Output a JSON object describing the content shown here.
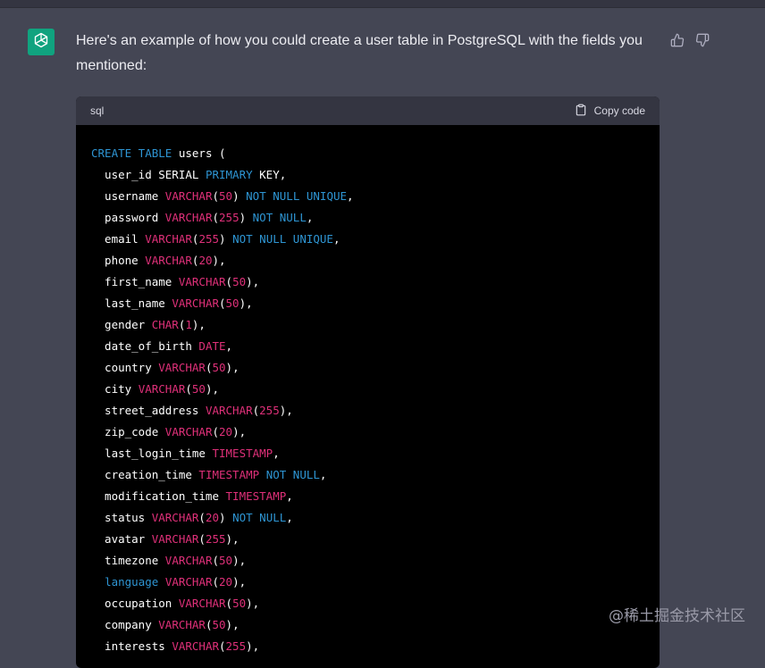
{
  "message": {
    "intro": "Here's an example of how you could create a user table in PostgreSQL with the fields you mentioned:"
  },
  "code_block": {
    "language": "sql",
    "copy_label": "Copy code",
    "lines": [
      [
        [
          "CREATE TABLE",
          "kw"
        ],
        [
          " users (",
          "plain"
        ]
      ],
      [
        [
          "  user_id SERIAL ",
          "plain"
        ],
        [
          "PRIMARY",
          "kw"
        ],
        [
          " KEY,",
          "plain"
        ]
      ],
      [
        [
          "  username ",
          "plain"
        ],
        [
          "VARCHAR",
          "type"
        ],
        [
          "(",
          "plain"
        ],
        [
          "50",
          "num"
        ],
        [
          ") ",
          "plain"
        ],
        [
          "NOT NULL UNIQUE",
          "kw"
        ],
        [
          ",",
          "plain"
        ]
      ],
      [
        [
          "  password ",
          "plain"
        ],
        [
          "VARCHAR",
          "type"
        ],
        [
          "(",
          "plain"
        ],
        [
          "255",
          "num"
        ],
        [
          ") ",
          "plain"
        ],
        [
          "NOT NULL",
          "kw"
        ],
        [
          ",",
          "plain"
        ]
      ],
      [
        [
          "  email ",
          "plain"
        ],
        [
          "VARCHAR",
          "type"
        ],
        [
          "(",
          "plain"
        ],
        [
          "255",
          "num"
        ],
        [
          ") ",
          "plain"
        ],
        [
          "NOT NULL UNIQUE",
          "kw"
        ],
        [
          ",",
          "plain"
        ]
      ],
      [
        [
          "  phone ",
          "plain"
        ],
        [
          "VARCHAR",
          "type"
        ],
        [
          "(",
          "plain"
        ],
        [
          "20",
          "num"
        ],
        [
          "),",
          "plain"
        ]
      ],
      [
        [
          "  first_name ",
          "plain"
        ],
        [
          "VARCHAR",
          "type"
        ],
        [
          "(",
          "plain"
        ],
        [
          "50",
          "num"
        ],
        [
          "),",
          "plain"
        ]
      ],
      [
        [
          "  last_name ",
          "plain"
        ],
        [
          "VARCHAR",
          "type"
        ],
        [
          "(",
          "plain"
        ],
        [
          "50",
          "num"
        ],
        [
          "),",
          "plain"
        ]
      ],
      [
        [
          "  gender ",
          "plain"
        ],
        [
          "CHAR",
          "type"
        ],
        [
          "(",
          "plain"
        ],
        [
          "1",
          "num"
        ],
        [
          "),",
          "plain"
        ]
      ],
      [
        [
          "  date_of_birth ",
          "plain"
        ],
        [
          "DATE",
          "type"
        ],
        [
          ",",
          "plain"
        ]
      ],
      [
        [
          "  country ",
          "plain"
        ],
        [
          "VARCHAR",
          "type"
        ],
        [
          "(",
          "plain"
        ],
        [
          "50",
          "num"
        ],
        [
          "),",
          "plain"
        ]
      ],
      [
        [
          "  city ",
          "plain"
        ],
        [
          "VARCHAR",
          "type"
        ],
        [
          "(",
          "plain"
        ],
        [
          "50",
          "num"
        ],
        [
          "),",
          "plain"
        ]
      ],
      [
        [
          "  street_address ",
          "plain"
        ],
        [
          "VARCHAR",
          "type"
        ],
        [
          "(",
          "plain"
        ],
        [
          "255",
          "num"
        ],
        [
          "),",
          "plain"
        ]
      ],
      [
        [
          "  zip_code ",
          "plain"
        ],
        [
          "VARCHAR",
          "type"
        ],
        [
          "(",
          "plain"
        ],
        [
          "20",
          "num"
        ],
        [
          "),",
          "plain"
        ]
      ],
      [
        [
          "  last_login_time ",
          "plain"
        ],
        [
          "TIMESTAMP",
          "type"
        ],
        [
          ",",
          "plain"
        ]
      ],
      [
        [
          "  creation_time ",
          "plain"
        ],
        [
          "TIMESTAMP",
          "type"
        ],
        [
          " ",
          "plain"
        ],
        [
          "NOT NULL",
          "kw"
        ],
        [
          ",",
          "plain"
        ]
      ],
      [
        [
          "  modification_time ",
          "plain"
        ],
        [
          "TIMESTAMP",
          "type"
        ],
        [
          ",",
          "plain"
        ]
      ],
      [
        [
          "  status ",
          "plain"
        ],
        [
          "VARCHAR",
          "type"
        ],
        [
          "(",
          "plain"
        ],
        [
          "20",
          "num"
        ],
        [
          ") ",
          "plain"
        ],
        [
          "NOT NULL",
          "kw"
        ],
        [
          ",",
          "plain"
        ]
      ],
      [
        [
          "  avatar ",
          "plain"
        ],
        [
          "VARCHAR",
          "type"
        ],
        [
          "(",
          "plain"
        ],
        [
          "255",
          "num"
        ],
        [
          "),",
          "plain"
        ]
      ],
      [
        [
          "  timezone ",
          "plain"
        ],
        [
          "VARCHAR",
          "type"
        ],
        [
          "(",
          "plain"
        ],
        [
          "50",
          "num"
        ],
        [
          "),",
          "plain"
        ]
      ],
      [
        [
          "  ",
          "plain"
        ],
        [
          "language",
          "kw"
        ],
        [
          " ",
          "plain"
        ],
        [
          "VARCHAR",
          "type"
        ],
        [
          "(",
          "plain"
        ],
        [
          "20",
          "num"
        ],
        [
          "),",
          "plain"
        ]
      ],
      [
        [
          "  occupation ",
          "plain"
        ],
        [
          "VARCHAR",
          "type"
        ],
        [
          "(",
          "plain"
        ],
        [
          "50",
          "num"
        ],
        [
          "),",
          "plain"
        ]
      ],
      [
        [
          "  company ",
          "plain"
        ],
        [
          "VARCHAR",
          "type"
        ],
        [
          "(",
          "plain"
        ],
        [
          "50",
          "num"
        ],
        [
          "),",
          "plain"
        ]
      ],
      [
        [
          "  interests ",
          "plain"
        ],
        [
          "VARCHAR",
          "type"
        ],
        [
          "(",
          "plain"
        ],
        [
          "255",
          "num"
        ],
        [
          "),",
          "plain"
        ]
      ]
    ]
  },
  "watermark": "@稀土掘金技术社区",
  "colors": {
    "background": "#444654",
    "avatar": "#10a37f",
    "code_bg": "#000000",
    "code_header": "#343541",
    "keyword": "#2e95d3",
    "type": "#df3079"
  },
  "icons": {
    "avatar": "openai-logo-icon",
    "like": "thumbs-up-icon",
    "dislike": "thumbs-down-icon",
    "copy": "clipboard-icon"
  }
}
